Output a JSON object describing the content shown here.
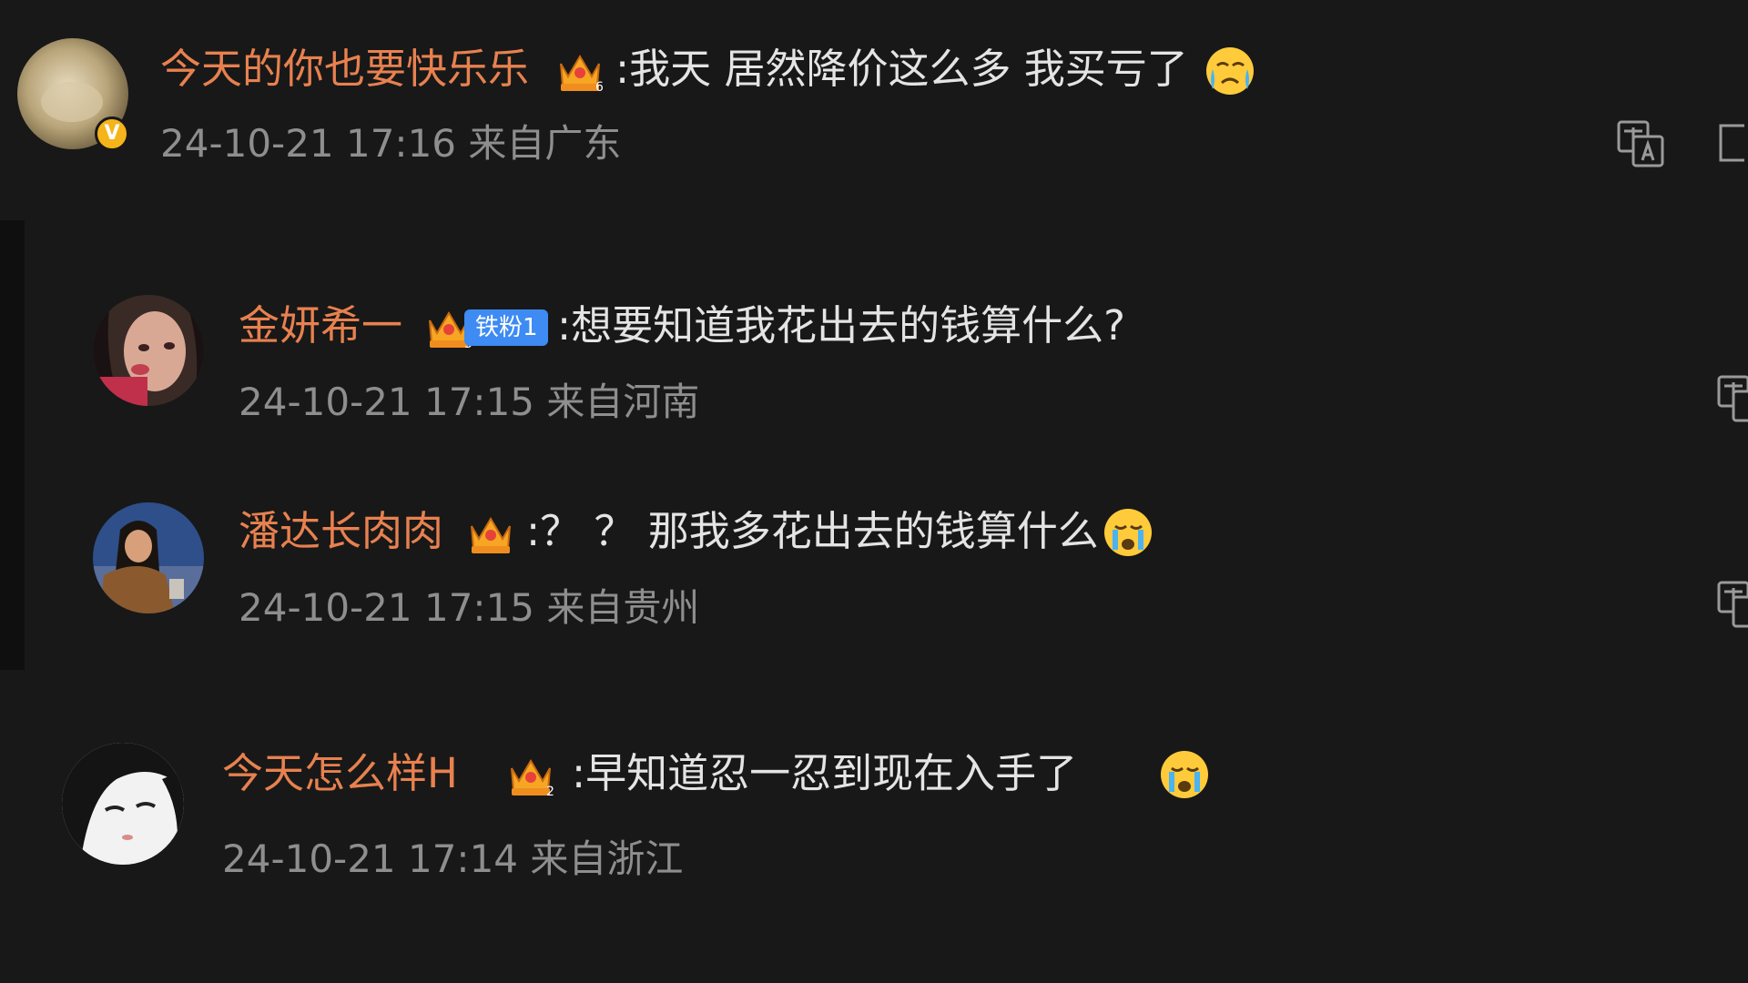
{
  "comments": [
    {
      "username": "今天的你也要快乐乐",
      "text": ":我天 居然降价这么多 我买亏了",
      "time": "24-10-21 17:16 来自广东",
      "verified_mark": "V",
      "crown_level": "6",
      "emoji": "crying-emoji"
    },
    {
      "username": "金妍希一",
      "text": ":想要知道我花出去的钱算什么?",
      "time": "24-10-21 17:15 来自河南",
      "fan_badge": "铁粉1",
      "crown_level": "3"
    },
    {
      "username": "潘达长肉肉",
      "text": ":？ ？ 那我多花出去的钱算什么",
      "time": "24-10-21 17:15 来自贵州",
      "crown_level": "",
      "emoji": "sad-emoji"
    },
    {
      "username": "今天怎么样H",
      "text": ":早知道忍一忍到现在入手了",
      "time": "24-10-21 17:14 来自浙江",
      "crown_level": "2",
      "emoji": "sad-emoji"
    }
  ],
  "icons": [
    "translate-icon",
    "reply-icon"
  ],
  "colors": {
    "background": "#181818",
    "username": "#e8814f",
    "text": "#e4e4e4",
    "time": "#8e8e8e",
    "badge": "#3d8bf3"
  }
}
